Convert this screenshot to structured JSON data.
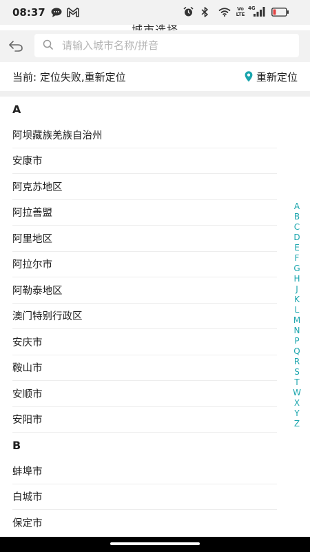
{
  "status_bar": {
    "time": "08:37",
    "network_label_top": "Vo",
    "network_label_bottom": "LTE",
    "signal_label": "4G"
  },
  "page": {
    "title": "城市选择"
  },
  "search": {
    "placeholder": "请输入城市名称/拼音",
    "value": ""
  },
  "location": {
    "current_text": "当前: 定位失败,重新定位",
    "relocate_label": "重新定位"
  },
  "accent_color": "#1aa5ad",
  "sections": [
    {
      "letter": "A",
      "cities": [
        "阿坝藏族羌族自治州",
        "安康市",
        "阿克苏地区",
        "阿拉善盟",
        "阿里地区",
        "阿拉尔市",
        "阿勒泰地区",
        "澳门特别行政区",
        "安庆市",
        "鞍山市",
        "安顺市",
        "安阳市"
      ]
    },
    {
      "letter": "B",
      "cities": [
        "蚌埠市",
        "白城市",
        "保定市"
      ]
    }
  ],
  "alphabet_index": [
    "A",
    "B",
    "C",
    "D",
    "E",
    "F",
    "G",
    "H",
    "J",
    "K",
    "L",
    "M",
    "N",
    "P",
    "Q",
    "R",
    "S",
    "T",
    "W",
    "X",
    "Y",
    "Z"
  ]
}
